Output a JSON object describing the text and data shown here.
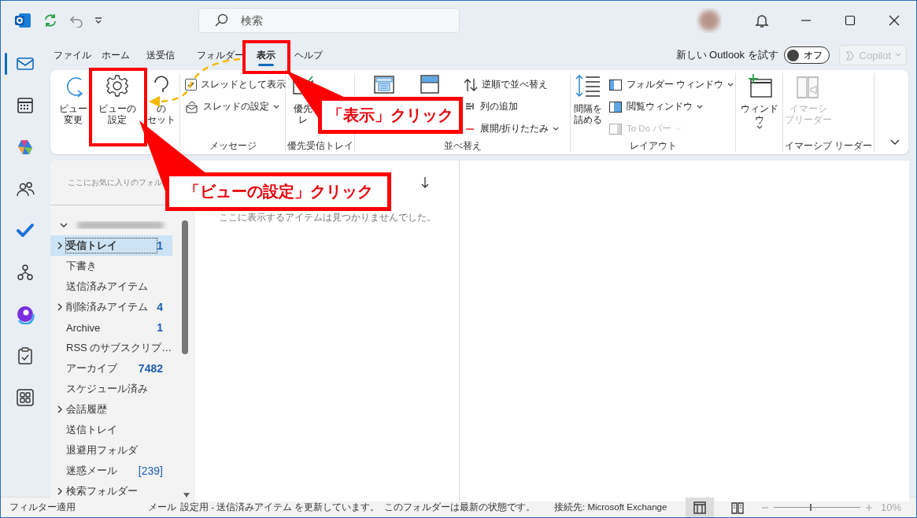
{
  "title_bar": {
    "search_placeholder": "検索"
  },
  "rail": [
    {
      "selected": true
    },
    {
      "selected": false
    },
    {
      "selected": false
    },
    {
      "selected": false
    },
    {
      "selected": false
    },
    {
      "selected": false
    },
    {
      "selected": false
    },
    {
      "selected": false
    },
    {
      "selected": false
    }
  ],
  "menu_tabs": [
    {
      "label": "ファイル",
      "selected": false
    },
    {
      "label": "ホーム",
      "selected": false
    },
    {
      "label": "送受信",
      "selected": false
    },
    {
      "label": "フォルダー",
      "selected": false
    },
    {
      "label": "表示",
      "selected": true
    },
    {
      "label": "ヘルプ",
      "selected": false
    }
  ],
  "new_outlook": {
    "label": "新しい Outlook を試す",
    "toggle": {
      "on": false,
      "label": "オフ"
    }
  },
  "copilot": {
    "label": "Copilot",
    "disabled": true
  },
  "ribbon": {
    "groups": [
      {
        "items": [
          {
            "kind": "large",
            "lines": [
              "ビュー",
              "変更"
            ],
            "disabled": false
          },
          {
            "kind": "large",
            "lines": [
              "ビューの",
              "設定"
            ],
            "disabled": false
          },
          {
            "kind": "large",
            "lines": [
              "の",
              "セット"
            ],
            "disabled": false
          }
        ]
      },
      {
        "label": "メッセージ",
        "items": [
          {
            "kind": "checkbox",
            "label": "スレッドとして表示",
            "checked": true,
            "disabled": false
          },
          {
            "kind": "small",
            "label": "スレッドの設定",
            "dropdown": true,
            "disabled": false
          }
        ]
      },
      {
        "label": "優先受信トレイ",
        "items": [
          {
            "kind": "large",
            "lines": [
              "優先",
              "レ"
            ],
            "disabled": false
          }
        ]
      },
      {
        "label": "並べ替え",
        "items": [
          {
            "kind": "large",
            "disabled": false
          },
          {
            "kind": "large",
            "disabled": false
          },
          {
            "kind": "small",
            "label": "逆順で並べ替え",
            "dropdown": false,
            "disabled": false
          },
          {
            "kind": "small",
            "label": "列の追加",
            "dropdown": false,
            "disabled": false
          },
          {
            "kind": "small",
            "label": "展開/折りたたみ",
            "dropdown": true,
            "disabled": false
          }
        ]
      },
      {
        "label": "レイアウト",
        "items": [
          {
            "kind": "large",
            "lines": [
              "間隔を",
              "詰める"
            ],
            "disabled": false
          },
          {
            "kind": "small",
            "label": "フォルダー ウィンドウ",
            "dropdown": true,
            "disabled": false
          },
          {
            "kind": "small",
            "label": "閲覧ウィンドウ",
            "dropdown": true,
            "disabled": false
          },
          {
            "kind": "small",
            "label": "To Do バー",
            "dropdown": true,
            "disabled": true
          }
        ]
      },
      {
        "items": [
          {
            "kind": "large",
            "lines": [
              "ウィンドウ"
            ],
            "dropdown": true,
            "disabled": false
          }
        ]
      },
      {
        "label": "イマーシブ リーダー",
        "items": [
          {
            "kind": "large",
            "lines": [
              "イマーシ",
              "ブリーダー"
            ],
            "disabled": true
          }
        ]
      }
    ]
  },
  "folder_pane": {
    "favorites_placeholder": "ここにお気に入りのフォル",
    "account": {
      "expanded": true
    },
    "folders": [
      {
        "name": "受信トレイ",
        "count": "1",
        "unread": true,
        "expandable": true,
        "selected": true
      },
      {
        "name": "下書き",
        "expandable": false,
        "selected": false
      },
      {
        "name": "送信済みアイテム",
        "expandable": false,
        "selected": false
      },
      {
        "name": "削除済みアイテム",
        "count": "4",
        "unread": true,
        "expandable": true,
        "selected": false
      },
      {
        "name": "Archive",
        "count": "1",
        "unread": true,
        "expandable": false,
        "selected": false
      },
      {
        "name": "RSS のサブスクリプ…",
        "expandable": false,
        "selected": false
      },
      {
        "name": "アーカイブ",
        "count": "7482",
        "unread": true,
        "expandable": false,
        "selected": false
      },
      {
        "name": "スケジュール済み",
        "expandable": false,
        "selected": false
      },
      {
        "name": "会話履歴",
        "expandable": true,
        "selected": false
      },
      {
        "name": "送信トレイ",
        "expandable": false,
        "selected": false
      },
      {
        "name": "退避用フォルダ",
        "expandable": false,
        "selected": false
      },
      {
        "name": "迷惑メール",
        "count": "[239]",
        "unread": false,
        "expandable": false,
        "selected": false
      },
      {
        "name": "検索フォルダー",
        "expandable": true,
        "selected": false
      }
    ]
  },
  "message_list": {
    "empty_text": "ここに表示するアイテムは見つかりませんでした。"
  },
  "status_bar": {
    "filter": "フィルター適用",
    "messages": [
      "メール",
      "設定用 - 送信済みアイテム を更新しています。",
      "このフォルダーは最新の状態です。",
      "接続先: Microsoft Exchange"
    ],
    "view_buttons": [
      {
        "selected": true
      },
      {
        "selected": false
      }
    ],
    "zoom": {
      "level": 0.42,
      "label": "10%"
    }
  },
  "callouts": [
    {
      "text": "「表示」クリック"
    },
    {
      "text": "「ビューの設定」クリック"
    }
  ]
}
